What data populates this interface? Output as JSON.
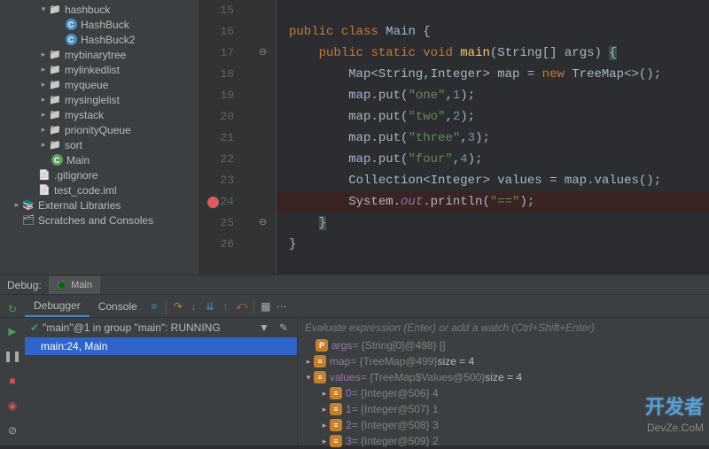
{
  "tree": {
    "hashbuck": "hashbuck",
    "hashbuck1": "HashBuck",
    "hashbuck2": "HashBuck2",
    "mybinarytree": "mybinarytree",
    "mylinkedlist": "mylinkedlist",
    "myqueue": "myqueue",
    "mysinglelist": "mysinglelist",
    "mystack": "mystack",
    "prionityQueue": "prionityQueue",
    "sort": "sort",
    "main": "Main",
    "gitignore": ".gitignore",
    "testcode": "test_code.iml",
    "extlib": "External Libraries",
    "scratches": "Scratches and Consoles"
  },
  "lines": [
    "15",
    "16",
    "17",
    "18",
    "19",
    "20",
    "21",
    "22",
    "23",
    "24",
    "25",
    "26"
  ],
  "code": {
    "l16_kw1": "public",
    "l16_kw2": "class",
    "l16_cls": "Main",
    "l16_br": "{",
    "l17_kw1": "public",
    "l17_kw2": "static",
    "l17_kw3": "void",
    "l17_fn": "main",
    "l17_t1": "(String[] args) ",
    "l17_br": "{",
    "l18_t1": "Map<String,Integer> map = ",
    "l18_kw": "new",
    "l18_t2": " TreeMap<>();",
    "l19_t1": "map.put(",
    "l19_s": "\"one\"",
    "l19_c": ",",
    "l19_n": "1",
    "l19_t2": ");",
    "l20_t1": "map.put(",
    "l20_s": "\"two\"",
    "l20_c": ",",
    "l20_n": "2",
    "l20_t2": ");",
    "l21_t1": "map.put(",
    "l21_s": "\"three\"",
    "l21_c": ",",
    "l21_n": "3",
    "l21_t2": ");",
    "l22_t1": "map.put(",
    "l22_s": "\"four\"",
    "l22_c": ",",
    "l22_n": "4",
    "l22_t2": ");",
    "l23_t1": "Collection<Integer> values = map.values();",
    "l24_t1": "System.",
    "l24_o": "out",
    "l24_t2": ".println(",
    "l24_s": "\"==\"",
    "l24_t3": ");",
    "l25_br": "}",
    "l26_br": "}"
  },
  "debug": {
    "title": "Debug:",
    "tab": "Main",
    "debugger": "Debugger",
    "console": "Console",
    "thread": "\"main\"@1 in group \"main\": RUNNING",
    "frame": "main:24, Main",
    "watch_hint": "Evaluate expression (Enter) or add a watch (Ctrl+Shift+Enter)"
  },
  "vars": {
    "args_n": "args",
    "args_v": " = {String[0]@498} []",
    "map_n": "map",
    "map_v": " = {TreeMap@499} ",
    "map_s": " size = 4",
    "values_n": "values",
    "values_v": " = {TreeMap$Values@500} ",
    "values_s": " size = 4",
    "v0_n": "0",
    "v0_v": " = {Integer@506} 4",
    "v1_n": "1",
    "v1_v": " = {Integer@507} 1",
    "v2_n": "2",
    "v2_v": " = {Integer@508} 3",
    "v3_n": "3",
    "v3_v": " = {Integer@509} 2"
  },
  "watermark": "开发者",
  "watermark_sub": "DevZe.CoM"
}
